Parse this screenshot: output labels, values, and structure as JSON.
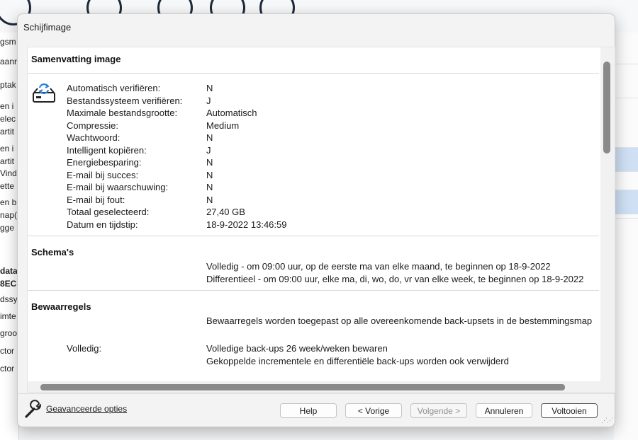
{
  "background": {
    "left_fragments": [
      "gsm",
      "aanr",
      "ptak",
      "en i",
      "elec",
      "artit",
      "en i",
      "artit",
      "Vind",
      "ette",
      "en b",
      "nap(",
      "gge",
      "data",
      "8EC",
      "dssy",
      "imte",
      "groo",
      "ctor",
      "ctor"
    ]
  },
  "dialog": {
    "title": "Schijfimage"
  },
  "summary": {
    "heading": "Samenvatting image",
    "rows": [
      {
        "label": "Automatisch verifiëren:",
        "value": "N"
      },
      {
        "label": "Bestandssysteem verifiëren:",
        "value": "J"
      },
      {
        "label": "Maximale bestandsgrootte:",
        "value": "Automatisch"
      },
      {
        "label": "Compressie:",
        "value": "Medium"
      },
      {
        "label": "Wachtwoord:",
        "value": "N"
      },
      {
        "label": "Intelligent kopiëren:",
        "value": "J"
      },
      {
        "label": "Energiebesparing:",
        "value": "N"
      },
      {
        "label": "E-mail bij succes:",
        "value": "N"
      },
      {
        "label": "E-mail bij waarschuwing:",
        "value": "N"
      },
      {
        "label": "E-mail bij fout:",
        "value": "N"
      },
      {
        "label": "Totaal geselecteerd:",
        "value": "27,40 GB"
      },
      {
        "label": "Datum en tijdstip:",
        "value": "18-9-2022 13:46:59"
      }
    ]
  },
  "schedules": {
    "heading": "Schema's",
    "items": [
      "Volledig - om 09:00 uur, op de eerste ma van elke maand, te beginnen op 18-9-2022",
      "Differentieel - om 09:00 uur, elke ma, di, wo, do, vr van elke week, te beginnen op 18-9-2022"
    ]
  },
  "retention": {
    "heading": "Bewaarregels",
    "intro": "Bewaarregels worden toegepast op alle overeenkomende back-upsets in de bestemmingsmap",
    "full_label": "Volledig:",
    "full_lines": [
      "Volledige back-ups 26 week/weken bewaren",
      "Gekoppelde incrementele en differentiële back-ups worden ook verwijderd"
    ]
  },
  "footer": {
    "advanced_link": "Geavanceerde opties",
    "buttons": {
      "help": "Help",
      "back": "< Vorige",
      "next": "Volgende >",
      "cancel": "Annuleren",
      "finish": "Voltooien"
    }
  },
  "colors": {
    "accent_blue": "#2f7fd0",
    "selected_row": "#cfe0f4"
  }
}
